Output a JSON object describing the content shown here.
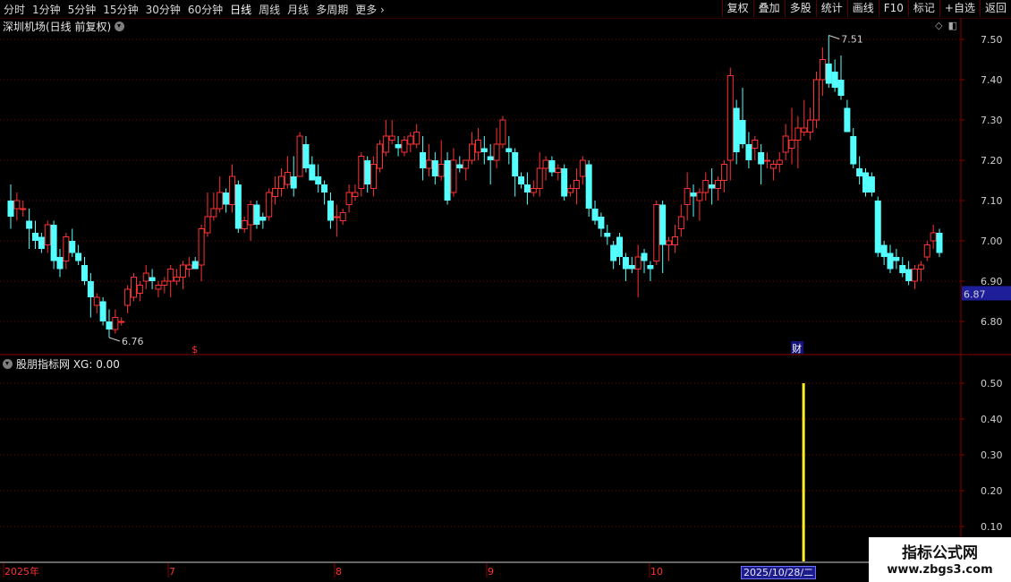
{
  "toolbar": {
    "periods": [
      "分时",
      "1分钟",
      "5分钟",
      "15分钟",
      "30分钟",
      "60分钟",
      "日线",
      "周线",
      "月线",
      "多周期",
      "更多"
    ],
    "active_period": "日线",
    "right_buttons": [
      "复权",
      "叠加",
      "多股",
      "统计",
      "画线",
      "F10",
      "标记",
      "+自选",
      "返回"
    ]
  },
  "main_chart": {
    "title": "深圳机场(日线 前复权)",
    "current_price_label": "6.87",
    "high_marker": "7.51",
    "low_marker": "6.76",
    "event_markers": [
      "$",
      "财"
    ]
  },
  "indicator": {
    "title": "股朋指标网 XG: 0.00"
  },
  "chart_data": [
    {
      "type": "candlestick",
      "title": "深圳机场(日线 前复权)",
      "ylim": [
        6.7,
        7.55
      ],
      "y_ticks": [
        "7.50",
        "7.40",
        "7.30",
        "7.20",
        "7.10",
        "7.00",
        "6.90",
        "6.80"
      ],
      "x_labels": [
        "2025年",
        "7",
        "8",
        "9",
        "10"
      ],
      "selected_date_label": "2025/10/28/二",
      "annotations": {
        "high": 7.51,
        "low": 6.76,
        "last": 6.87
      },
      "ohlc": [
        [
          7.1,
          7.14,
          7.03,
          7.06
        ],
        [
          7.08,
          7.12,
          7.05,
          7.1
        ],
        [
          7.08,
          7.1,
          7.06,
          7.08
        ],
        [
          7.05,
          7.08,
          6.98,
          7.03
        ],
        [
          7.02,
          7.05,
          6.98,
          7.0
        ],
        [
          7.01,
          7.02,
          6.97,
          6.98
        ],
        [
          6.99,
          7.05,
          6.97,
          7.04
        ],
        [
          7.04,
          7.05,
          6.93,
          6.95
        ],
        [
          6.96,
          6.98,
          6.91,
          6.93
        ],
        [
          6.95,
          7.02,
          6.93,
          7.01
        ],
        [
          7.0,
          7.03,
          6.96,
          6.97
        ],
        [
          6.97,
          6.99,
          6.94,
          6.95
        ],
        [
          6.94,
          6.96,
          6.89,
          6.9
        ],
        [
          6.9,
          6.92,
          6.81,
          6.86
        ],
        [
          6.84,
          6.87,
          6.82,
          6.86
        ],
        [
          6.85,
          6.86,
          6.79,
          6.8
        ],
        [
          6.8,
          6.83,
          6.76,
          6.78
        ],
        [
          6.78,
          6.83,
          6.77,
          6.81
        ],
        [
          6.8,
          6.81,
          6.79,
          6.8
        ],
        [
          6.84,
          6.89,
          6.82,
          6.88
        ],
        [
          6.86,
          6.92,
          6.85,
          6.91
        ],
        [
          6.87,
          6.9,
          6.85,
          6.89
        ],
        [
          6.9,
          6.94,
          6.88,
          6.92
        ],
        [
          6.91,
          6.93,
          6.88,
          6.9
        ],
        [
          6.88,
          6.9,
          6.86,
          6.89
        ],
        [
          6.89,
          6.91,
          6.87,
          6.9
        ],
        [
          6.9,
          6.94,
          6.86,
          6.93
        ],
        [
          6.9,
          6.93,
          6.89,
          6.91
        ],
        [
          6.91,
          6.95,
          6.88,
          6.94
        ],
        [
          6.93,
          6.96,
          6.91,
          6.94
        ],
        [
          6.95,
          6.96,
          6.93,
          6.93
        ],
        [
          6.94,
          7.04,
          6.9,
          7.03
        ],
        [
          7.02,
          7.12,
          7.01,
          7.06
        ],
        [
          7.06,
          7.12,
          7.05,
          7.08
        ],
        [
          7.08,
          7.16,
          7.07,
          7.12
        ],
        [
          7.12,
          7.13,
          7.07,
          7.09
        ],
        [
          7.09,
          7.19,
          7.07,
          7.16
        ],
        [
          7.14,
          7.15,
          7.02,
          7.03
        ],
        [
          7.03,
          7.06,
          7.02,
          7.05
        ],
        [
          7.04,
          7.1,
          7.0,
          7.09
        ],
        [
          7.09,
          7.1,
          7.03,
          7.04
        ],
        [
          7.06,
          7.07,
          7.03,
          7.05
        ],
        [
          7.06,
          7.13,
          7.05,
          7.12
        ],
        [
          7.11,
          7.16,
          7.09,
          7.13
        ],
        [
          7.13,
          7.18,
          7.11,
          7.16
        ],
        [
          7.14,
          7.21,
          7.13,
          7.17
        ],
        [
          7.16,
          7.21,
          7.11,
          7.13
        ],
        [
          7.16,
          7.27,
          7.16,
          7.26
        ],
        [
          7.24,
          7.26,
          7.17,
          7.18
        ],
        [
          7.19,
          7.21,
          7.15,
          7.15
        ],
        [
          7.16,
          7.19,
          7.12,
          7.14
        ],
        [
          7.14,
          7.15,
          7.09,
          7.12
        ],
        [
          7.1,
          7.12,
          7.03,
          7.05
        ],
        [
          7.06,
          7.09,
          7.01,
          7.06
        ],
        [
          7.05,
          7.08,
          7.04,
          7.07
        ],
        [
          7.09,
          7.14,
          7.07,
          7.12
        ],
        [
          7.11,
          7.14,
          7.1,
          7.12
        ],
        [
          7.13,
          7.22,
          7.11,
          7.21
        ],
        [
          7.2,
          7.21,
          7.12,
          7.14
        ],
        [
          7.13,
          7.21,
          7.11,
          7.19
        ],
        [
          7.18,
          7.25,
          7.17,
          7.24
        ],
        [
          7.22,
          7.3,
          7.21,
          7.26
        ],
        [
          7.25,
          7.3,
          7.24,
          7.26
        ],
        [
          7.24,
          7.26,
          7.21,
          7.23
        ],
        [
          7.22,
          7.26,
          7.21,
          7.25
        ],
        [
          7.24,
          7.27,
          7.22,
          7.26
        ],
        [
          7.24,
          7.29,
          7.23,
          7.27
        ],
        [
          7.22,
          7.26,
          7.15,
          7.18
        ],
        [
          7.18,
          7.24,
          7.16,
          7.2
        ],
        [
          7.2,
          7.22,
          7.14,
          7.16
        ],
        [
          7.16,
          7.25,
          7.15,
          7.19
        ],
        [
          7.2,
          7.22,
          7.09,
          7.1
        ],
        [
          7.12,
          7.23,
          7.11,
          7.2
        ],
        [
          7.19,
          7.21,
          7.17,
          7.18
        ],
        [
          7.18,
          7.2,
          7.15,
          7.2
        ],
        [
          7.2,
          7.27,
          7.19,
          7.24
        ],
        [
          7.22,
          7.28,
          7.2,
          7.25
        ],
        [
          7.23,
          7.26,
          7.19,
          7.22
        ],
        [
          7.21,
          7.24,
          7.14,
          7.2
        ],
        [
          7.2,
          7.28,
          7.18,
          7.24
        ],
        [
          7.24,
          7.31,
          7.23,
          7.3
        ],
        [
          7.23,
          7.26,
          7.19,
          7.22
        ],
        [
          7.22,
          7.23,
          7.11,
          7.16
        ],
        [
          7.16,
          7.17,
          7.13,
          7.14
        ],
        [
          7.14,
          7.17,
          7.09,
          7.12
        ],
        [
          7.12,
          7.15,
          7.11,
          7.13
        ],
        [
          7.13,
          7.22,
          7.11,
          7.18
        ],
        [
          7.18,
          7.21,
          7.15,
          7.2
        ],
        [
          7.2,
          7.21,
          7.16,
          7.17
        ],
        [
          7.17,
          7.19,
          7.15,
          7.18
        ],
        [
          7.18,
          7.19,
          7.1,
          7.11
        ],
        [
          7.12,
          7.14,
          7.11,
          7.13
        ],
        [
          7.13,
          7.18,
          7.09,
          7.15
        ],
        [
          7.16,
          7.21,
          7.14,
          7.2
        ],
        [
          7.19,
          7.2,
          7.06,
          7.08
        ],
        [
          7.08,
          7.1,
          7.04,
          7.05
        ],
        [
          7.06,
          7.07,
          7.01,
          7.03
        ],
        [
          7.02,
          7.04,
          6.99,
          7.01
        ],
        [
          6.99,
          7.0,
          6.93,
          6.95
        ],
        [
          7.01,
          7.02,
          6.94,
          6.96
        ],
        [
          6.96,
          6.97,
          6.9,
          6.93
        ],
        [
          6.94,
          6.96,
          6.92,
          6.93
        ],
        [
          6.93,
          6.99,
          6.86,
          6.96
        ],
        [
          6.97,
          6.98,
          6.92,
          6.95
        ],
        [
          6.94,
          6.95,
          6.9,
          6.93
        ],
        [
          6.95,
          7.1,
          6.94,
          7.09
        ],
        [
          7.09,
          7.1,
          6.92,
          6.99
        ],
        [
          6.99,
          7.01,
          6.95,
          7.0
        ],
        [
          6.99,
          7.04,
          6.97,
          7.01
        ],
        [
          7.03,
          7.09,
          7.01,
          7.06
        ],
        [
          7.09,
          7.17,
          7.05,
          7.13
        ],
        [
          7.12,
          7.14,
          7.06,
          7.11
        ],
        [
          7.1,
          7.13,
          7.05,
          7.12
        ],
        [
          7.12,
          7.17,
          7.1,
          7.15
        ],
        [
          7.14,
          7.18,
          7.09,
          7.13
        ],
        [
          7.13,
          7.16,
          7.1,
          7.15
        ],
        [
          7.15,
          7.2,
          7.12,
          7.19
        ],
        [
          7.2,
          7.43,
          7.15,
          7.41
        ],
        [
          7.33,
          7.35,
          7.19,
          7.22
        ],
        [
          7.3,
          7.38,
          7.23,
          7.24
        ],
        [
          7.24,
          7.27,
          7.18,
          7.2
        ],
        [
          7.23,
          7.26,
          7.2,
          7.25
        ],
        [
          7.22,
          7.24,
          7.14,
          7.19
        ],
        [
          7.2,
          7.22,
          7.18,
          7.2
        ],
        [
          7.18,
          7.2,
          7.15,
          7.19
        ],
        [
          7.19,
          7.22,
          7.17,
          7.2
        ],
        [
          7.22,
          7.29,
          7.2,
          7.26
        ],
        [
          7.23,
          7.33,
          7.19,
          7.25
        ],
        [
          7.25,
          7.31,
          7.18,
          7.28
        ],
        [
          7.27,
          7.35,
          7.26,
          7.28
        ],
        [
          7.27,
          7.33,
          7.25,
          7.3
        ],
        [
          7.3,
          7.42,
          7.28,
          7.4
        ],
        [
          7.4,
          7.48,
          7.36,
          7.45
        ],
        [
          7.44,
          7.51,
          7.38,
          7.39
        ],
        [
          7.42,
          7.45,
          7.37,
          7.38
        ],
        [
          7.4,
          7.46,
          7.35,
          7.36
        ],
        [
          7.33,
          7.35,
          7.27,
          7.27
        ],
        [
          7.26,
          7.28,
          7.18,
          7.19
        ],
        [
          7.18,
          7.21,
          7.14,
          7.16
        ],
        [
          7.17,
          7.18,
          7.11,
          7.12
        ],
        [
          7.16,
          7.17,
          7.11,
          7.12
        ],
        [
          7.1,
          7.11,
          6.96,
          6.97
        ],
        [
          6.99,
          7.0,
          6.94,
          6.96
        ],
        [
          6.97,
          6.99,
          6.92,
          6.93
        ],
        [
          6.96,
          6.98,
          6.93,
          6.95
        ],
        [
          6.94,
          6.96,
          6.91,
          6.92
        ],
        [
          6.93,
          6.95,
          6.89,
          6.9
        ],
        [
          6.9,
          6.94,
          6.88,
          6.93
        ],
        [
          6.93,
          6.95,
          6.9,
          6.94
        ],
        [
          6.96,
          7.0,
          6.95,
          6.99
        ],
        [
          7.0,
          7.04,
          6.98,
          7.02
        ],
        [
          7.02,
          7.03,
          6.96,
          6.97
        ]
      ]
    },
    {
      "type": "bar",
      "title": "股朋指标网 XG: 0.00",
      "ylim": [
        0,
        0.55
      ],
      "y_ticks": [
        "0.50",
        "0.40",
        "0.30",
        "0.20",
        "0.10"
      ],
      "signal_index": 126,
      "signal_value": 0.5
    }
  ]
}
